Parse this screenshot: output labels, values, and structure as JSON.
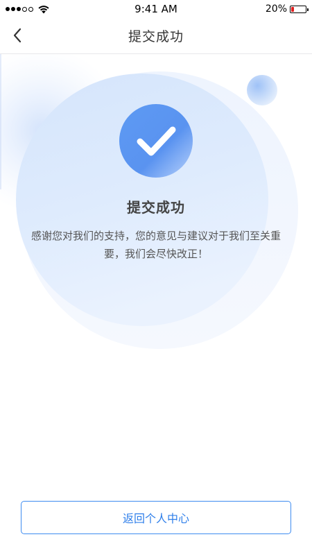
{
  "status_bar": {
    "time": "9:41 AM",
    "battery_percent": "20%",
    "battery_level": 0.2,
    "signal_bars_filled": 3,
    "signal_bars_total": 5
  },
  "nav": {
    "title": "提交成功",
    "back_icon": "chevron-left-icon"
  },
  "success": {
    "icon": "checkmark-icon",
    "title": "提交成功",
    "message": "感谢您对我们的支持，您的意见与建议对于我们至关重要，我们会尽快改正！"
  },
  "actions": {
    "return_label": "返回个人中心"
  },
  "colors": {
    "accent": "#2f7fea",
    "battery_low": "#e02020",
    "circle_light": "#dce9fc"
  }
}
